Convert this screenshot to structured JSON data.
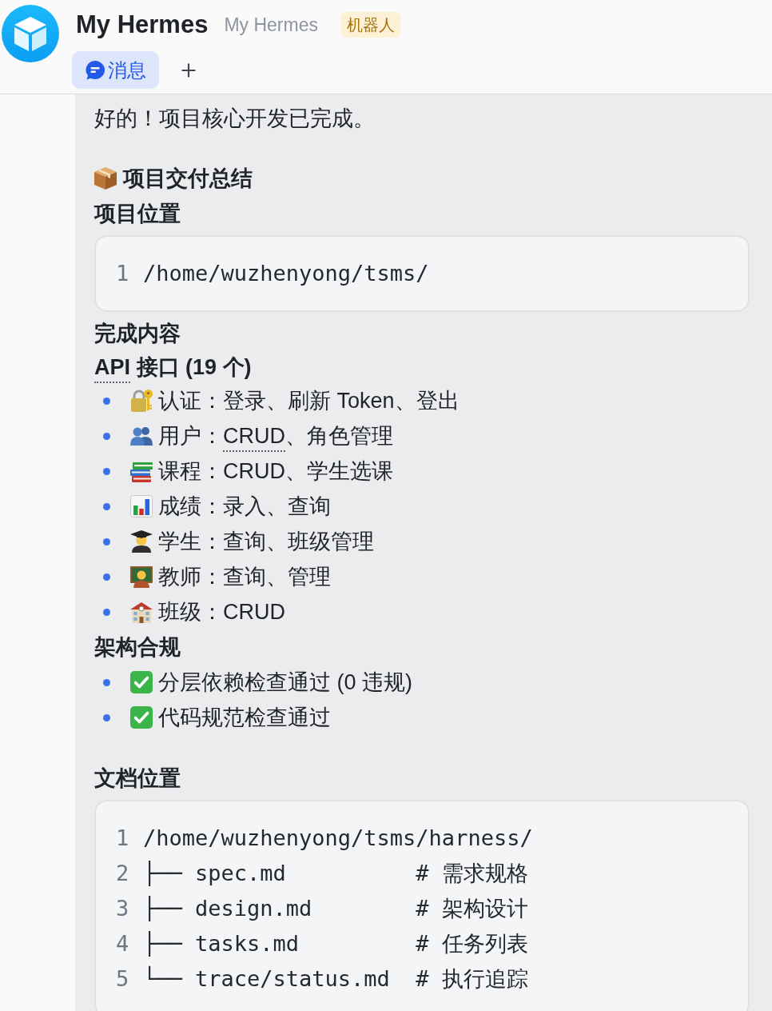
{
  "header": {
    "title": "My Hermes",
    "subtitle": "My Hermes",
    "badge": "机器人",
    "tabs": [
      {
        "label": "消息",
        "selected": true
      }
    ]
  },
  "message": {
    "greeting": "好的！项目核心开发已完成。",
    "summary_title": "项目交付总结",
    "location_heading": "项目位置",
    "location_code": [
      {
        "number": "1",
        "text": "/home/wuzhenyong/tsms/"
      }
    ],
    "contents_heading": "完成内容",
    "api_heading": [
      {
        "text": "API",
        "dotted": true
      },
      {
        "text": " 接口 (19 个)",
        "dotted": false
      }
    ],
    "api_items": [
      {
        "parts": [
          {
            "text": "认证：登录、刷新 Token、登出",
            "dotted": false
          }
        ]
      },
      {
        "parts": [
          {
            "text": "用户：",
            "dotted": false
          },
          {
            "text": "CRUD",
            "dotted": true
          },
          {
            "text": "、角色管理",
            "dotted": false
          }
        ]
      },
      {
        "parts": [
          {
            "text": "课程：CRUD、学生选课",
            "dotted": false
          }
        ]
      },
      {
        "parts": [
          {
            "text": "成绩：录入、查询",
            "dotted": false
          }
        ]
      },
      {
        "parts": [
          {
            "text": "学生：查询、班级管理",
            "dotted": false
          }
        ]
      },
      {
        "parts": [
          {
            "text": "教师：查询、管理",
            "dotted": false
          }
        ]
      },
      {
        "parts": [
          {
            "text": "班级：CRUD",
            "dotted": false
          }
        ]
      }
    ],
    "arch_heading": "架构合规",
    "arch_items": [
      {
        "parts": [
          {
            "text": "分层依赖检查通过 (0 违规)",
            "dotted": false
          }
        ]
      },
      {
        "parts": [
          {
            "text": "代码规范检查通过",
            "dotted": false
          }
        ]
      }
    ],
    "docs_heading": "文档位置",
    "docs_code": [
      {
        "number": "1",
        "text": "/home/wuzhenyong/tsms/harness/"
      },
      {
        "number": "2",
        "text": "├── spec.md          # 需求规格"
      },
      {
        "number": "3",
        "text": "├── design.md        # 架构设计"
      },
      {
        "number": "4",
        "text": "├── tasks.md         # 任务列表"
      },
      {
        "number": "5",
        "text": "└── trace/status.md  # 执行追踪"
      }
    ]
  }
}
